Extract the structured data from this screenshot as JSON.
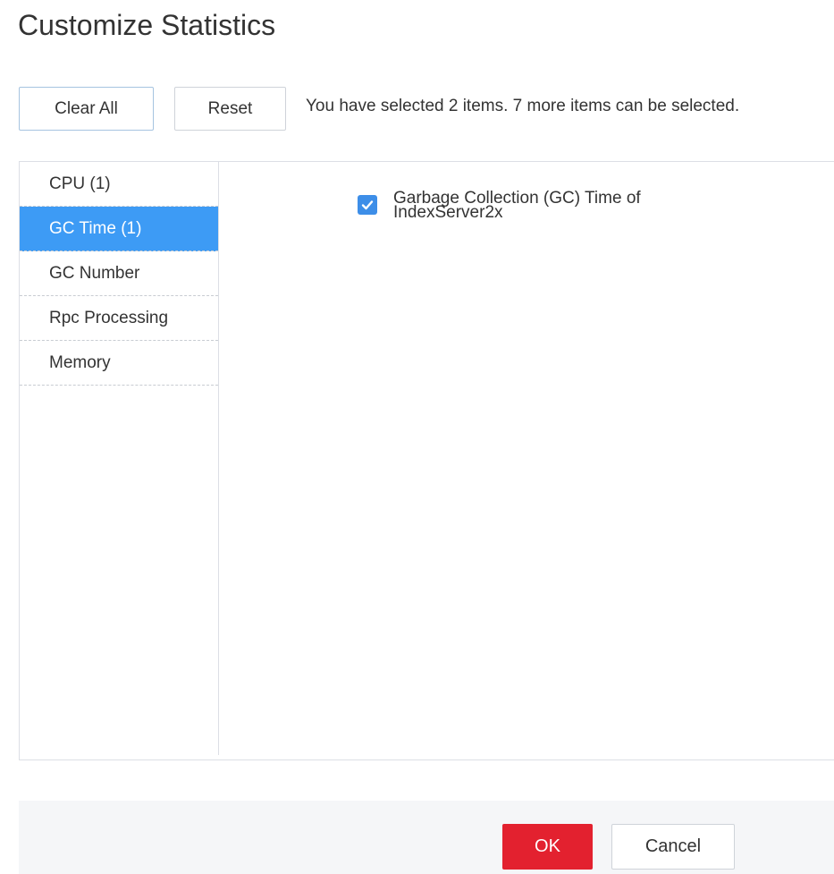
{
  "dialog": {
    "title": "Customize Statistics"
  },
  "toolbar": {
    "clear_all_label": "Clear All",
    "reset_label": "Reset",
    "hint": "You have selected 2 items. 7 more items can be selected."
  },
  "categories": [
    {
      "label": "CPU (1)",
      "active": false
    },
    {
      "label": "GC Time (1)",
      "active": true
    },
    {
      "label": "GC Number",
      "active": false
    },
    {
      "label": "Rpc Processing",
      "active": false
    },
    {
      "label": "Memory",
      "active": false
    }
  ],
  "items": [
    {
      "line1": "Garbage Collection (GC) Time of",
      "line2": "IndexServer2x",
      "checked": true
    }
  ],
  "footer": {
    "ok_label": "OK",
    "cancel_label": "Cancel"
  },
  "colors": {
    "accent": "#3d9bf5",
    "checkbox": "#3d8ee8",
    "primary_button": "#e3212f"
  },
  "icons": {
    "checkbox": "checkmark-icon"
  }
}
